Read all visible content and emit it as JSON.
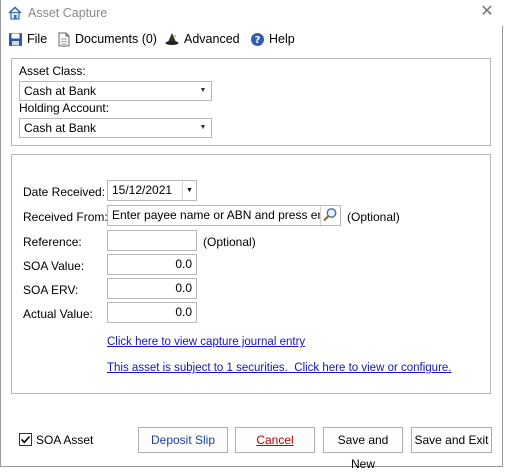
{
  "window": {
    "title": "Asset Capture",
    "close_glyph": "✕"
  },
  "toolbar": {
    "file_label": "File",
    "documents_label": "Documents (0)",
    "advanced_label": "Advanced",
    "help_label": "Help"
  },
  "top_group": {
    "asset_class_label": "Asset Class:",
    "asset_class_value": "Cash at Bank",
    "holding_account_label": "Holding Account:",
    "holding_account_value": "Cash at Bank"
  },
  "form": {
    "date_received_label": "Date Received:",
    "date_received_value": "15/12/2021",
    "received_from_label": "Received From:",
    "received_from_placeholder": "Enter payee name or ABN and press enter",
    "optional_label": "(Optional)",
    "reference_label": "Reference:",
    "reference_value": "",
    "soa_value_label": "SOA Value:",
    "soa_value": "0.0",
    "soa_erv_label": "SOA ERV:",
    "soa_erv": "0.0",
    "actual_value_label": "Actual Value:",
    "actual_value": "0.0",
    "journal_link": "Click here to view capture journal entry",
    "securities_link": "This asset is subject to 1 securities.  Click here to view or configure."
  },
  "footer": {
    "soa_asset_label": "SOA Asset",
    "soa_asset_checked": true,
    "deposit_slip_label": "Deposit Slip",
    "cancel_label": "Cancel",
    "save_new_label": "Save and New",
    "save_exit_label": "Save and Exit"
  },
  "icons": {
    "title": "house-icon",
    "file": "save-disk-icon",
    "documents": "document-icon",
    "advanced": "wizard-hat-icon",
    "help": "help-icon",
    "search": "magnifier-icon"
  }
}
